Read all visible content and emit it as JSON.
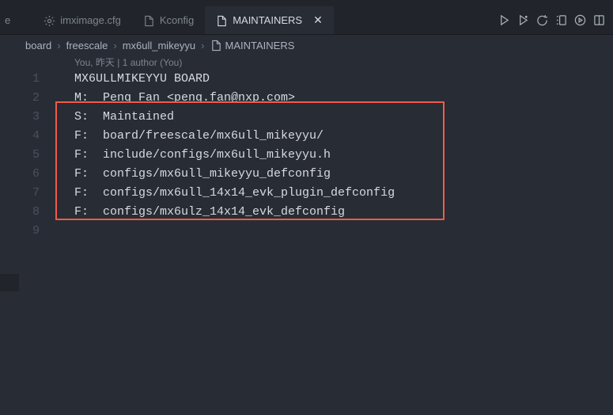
{
  "tabs": {
    "partial": "e",
    "t1": "imximage.cfg",
    "t2": "Kconfig",
    "t3": "MAINTAINERS"
  },
  "breadcrumb": {
    "c1": "board",
    "c2": "freescale",
    "c3": "mx6ull_mikeyyu",
    "c4": "MAINTAINERS"
  },
  "codelens": "You, 昨天 | 1 author (You)",
  "lineNumbers": [
    "1",
    "2",
    "3",
    "4",
    "5",
    "6",
    "7",
    "8",
    "9"
  ],
  "code": {
    "l1": "MX6ULLMIKEYYU BOARD",
    "l2": "M:  Peng Fan <peng.fan@nxp.com>",
    "l3": "S:  Maintained",
    "l4": "F:  board/freescale/mx6ull_mikeyyu/",
    "l5": "F:  include/configs/mx6ull_mikeyyu.h",
    "l6": "F:  configs/mx6ull_mikeyyu_defconfig",
    "l7": "F:  configs/mx6ull_14x14_evk_plugin_defconfig",
    "l8": "F:  configs/mx6ulz_14x14_evk_defconfig",
    "l9": ""
  }
}
